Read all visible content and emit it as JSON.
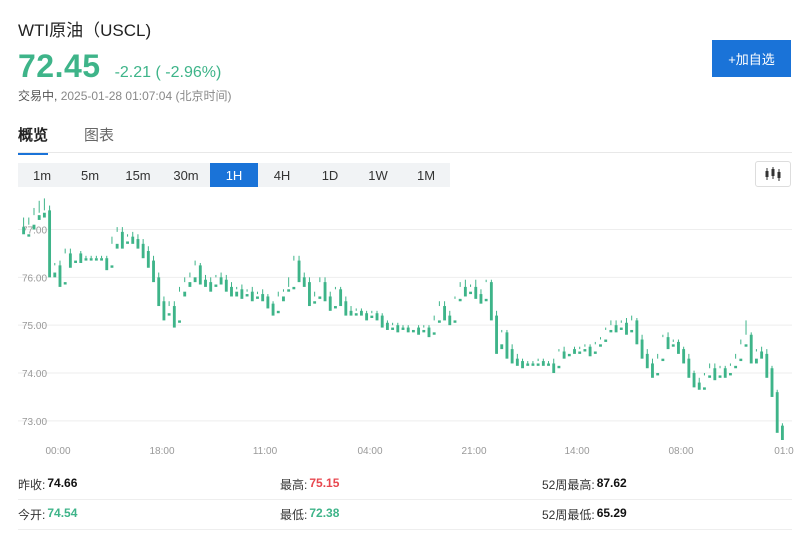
{
  "header": {
    "title": "WTI原油（USCL)",
    "price": "72.45",
    "change": "-2.21 ( -2.96%)",
    "status": "交易中,",
    "datetime": "2025-01-28 01:07:04 (北京时间)",
    "add_button": "+加自选"
  },
  "tabs": [
    {
      "label": "概览",
      "active": true
    },
    {
      "label": "图表",
      "active": false
    }
  ],
  "intervals": [
    {
      "label": "1m",
      "active": false
    },
    {
      "label": "5m",
      "active": false
    },
    {
      "label": "15m",
      "active": false
    },
    {
      "label": "30m",
      "active": false
    },
    {
      "label": "1H",
      "active": true
    },
    {
      "label": "4H",
      "active": false
    },
    {
      "label": "1D",
      "active": false
    },
    {
      "label": "1W",
      "active": false
    },
    {
      "label": "1M",
      "active": false
    }
  ],
  "chart_type_icon": "candlestick-icon",
  "colors": {
    "up": "#e8474f",
    "down": "#3eb489",
    "accent": "#1a73d8"
  },
  "chart_data": {
    "type": "candlestick",
    "y_ticks": [
      "73.00",
      "74.00",
      "75.00",
      "76.00",
      "77.00"
    ],
    "ylim": [
      72.6,
      77.7
    ],
    "x_ticks": [
      "00:00",
      "18:00",
      "11:00",
      "04:00",
      "21:00",
      "14:00",
      "08:00",
      "01:0"
    ],
    "grid": true,
    "candles": [
      [
        77.05,
        77.25,
        76.95,
        76.9
      ],
      [
        76.9,
        77.25,
        77.1,
        76.85
      ],
      [
        77.1,
        77.45,
        77.3,
        77.0
      ],
      [
        77.3,
        77.6,
        77.35,
        77.2
      ],
      [
        77.35,
        77.65,
        77.4,
        77.25
      ],
      [
        77.4,
        77.5,
        76.1,
        76.0
      ],
      [
        76.1,
        76.3,
        76.25,
        76.0
      ],
      [
        76.25,
        76.35,
        75.9,
        75.8
      ],
      [
        75.9,
        76.6,
        76.5,
        75.85
      ],
      [
        76.5,
        76.6,
        76.35,
        76.2
      ],
      [
        76.35,
        76.5,
        76.5,
        76.3
      ],
      [
        76.5,
        76.55,
        76.4,
        76.3
      ],
      [
        76.4,
        76.45,
        76.4,
        76.35
      ],
      [
        76.4,
        76.45,
        76.4,
        76.35
      ],
      [
        76.4,
        76.45,
        76.4,
        76.35
      ],
      [
        76.4,
        76.45,
        76.4,
        76.35
      ],
      [
        76.4,
        76.45,
        76.25,
        76.15
      ],
      [
        76.25,
        76.85,
        76.7,
        76.2
      ],
      [
        76.7,
        77.05,
        76.95,
        76.6
      ],
      [
        76.95,
        77.05,
        76.75,
        76.6
      ],
      [
        76.75,
        76.9,
        76.85,
        76.7
      ],
      [
        76.85,
        76.95,
        76.8,
        76.7
      ],
      [
        76.8,
        76.9,
        76.7,
        76.6
      ],
      [
        76.7,
        76.8,
        76.55,
        76.4
      ],
      [
        76.55,
        76.65,
        76.35,
        76.2
      ],
      [
        76.35,
        76.45,
        76.0,
        75.9
      ],
      [
        76.0,
        76.1,
        75.5,
        75.4
      ],
      [
        75.5,
        75.6,
        75.25,
        75.1
      ],
      [
        75.25,
        75.5,
        75.4,
        75.2
      ],
      [
        75.4,
        75.5,
        75.1,
        74.95
      ],
      [
        75.1,
        75.8,
        75.7,
        75.05
      ],
      [
        75.7,
        76.0,
        75.9,
        75.6
      ],
      [
        75.9,
        76.1,
        76.0,
        75.8
      ],
      [
        76.0,
        76.35,
        76.25,
        75.9
      ],
      [
        76.25,
        76.3,
        75.95,
        75.85
      ],
      [
        75.95,
        76.05,
        75.9,
        75.8
      ],
      [
        75.9,
        76.0,
        75.85,
        75.7
      ],
      [
        75.85,
        76.05,
        76.0,
        75.8
      ],
      [
        76.0,
        76.1,
        75.95,
        75.85
      ],
      [
        75.95,
        76.05,
        75.8,
        75.7
      ],
      [
        75.8,
        75.9,
        75.7,
        75.6
      ],
      [
        75.7,
        75.8,
        75.75,
        75.6
      ],
      [
        75.75,
        75.85,
        75.65,
        75.55
      ],
      [
        75.65,
        75.75,
        75.7,
        75.6
      ],
      [
        75.7,
        75.8,
        75.6,
        75.5
      ],
      [
        75.6,
        75.7,
        75.65,
        75.55
      ],
      [
        75.65,
        75.75,
        75.6,
        75.5
      ],
      [
        75.6,
        75.65,
        75.45,
        75.35
      ],
      [
        75.45,
        75.5,
        75.3,
        75.2
      ],
      [
        75.3,
        75.7,
        75.6,
        75.25
      ],
      [
        75.6,
        75.7,
        75.75,
        75.5
      ],
      [
        75.75,
        76.0,
        75.8,
        75.7
      ],
      [
        75.8,
        76.45,
        76.35,
        75.75
      ],
      [
        76.35,
        76.45,
        76.0,
        75.9
      ],
      [
        76.0,
        76.1,
        75.9,
        75.8
      ],
      [
        75.9,
        76.0,
        75.5,
        75.4
      ],
      [
        75.5,
        75.7,
        75.6,
        75.45
      ],
      [
        75.6,
        76.0,
        75.9,
        75.55
      ],
      [
        75.9,
        76.0,
        75.6,
        75.5
      ],
      [
        75.6,
        75.7,
        75.4,
        75.3
      ],
      [
        75.4,
        75.8,
        75.75,
        75.35
      ],
      [
        75.75,
        75.8,
        75.5,
        75.4
      ],
      [
        75.5,
        75.6,
        75.3,
        75.2
      ],
      [
        75.3,
        75.4,
        75.25,
        75.2
      ],
      [
        75.25,
        75.35,
        75.3,
        75.2
      ],
      [
        75.3,
        75.35,
        75.25,
        75.2
      ],
      [
        75.25,
        75.3,
        75.2,
        75.1
      ],
      [
        75.2,
        75.3,
        75.25,
        75.15
      ],
      [
        75.25,
        75.3,
        75.2,
        75.1
      ],
      [
        75.2,
        75.25,
        75.05,
        74.95
      ],
      [
        75.05,
        75.1,
        74.95,
        74.9
      ],
      [
        74.95,
        75.05,
        75.0,
        74.9
      ],
      [
        75.0,
        75.05,
        74.95,
        74.85
      ],
      [
        74.95,
        75.0,
        74.95,
        74.9
      ],
      [
        74.95,
        75.0,
        74.9,
        74.85
      ],
      [
        74.9,
        74.95,
        74.95,
        74.85
      ],
      [
        74.95,
        75.0,
        74.9,
        74.8
      ],
      [
        74.9,
        75.0,
        74.95,
        74.85
      ],
      [
        74.95,
        75.0,
        74.85,
        74.75
      ],
      [
        74.85,
        75.2,
        75.1,
        74.8
      ],
      [
        75.1,
        75.5,
        75.4,
        75.05
      ],
      [
        75.4,
        75.5,
        75.2,
        75.1
      ],
      [
        75.2,
        75.3,
        75.1,
        75.0
      ],
      [
        75.1,
        75.6,
        75.55,
        75.05
      ],
      [
        75.55,
        75.9,
        75.8,
        75.5
      ],
      [
        75.8,
        75.95,
        75.7,
        75.6
      ],
      [
        75.7,
        75.85,
        75.8,
        75.65
      ],
      [
        75.8,
        75.95,
        75.65,
        75.55
      ],
      [
        75.65,
        75.75,
        75.55,
        75.45
      ],
      [
        75.55,
        75.95,
        75.9,
        75.5
      ],
      [
        75.9,
        75.95,
        75.2,
        75.1
      ],
      [
        75.2,
        75.3,
        74.6,
        74.4
      ],
      [
        74.6,
        74.9,
        74.85,
        74.5
      ],
      [
        74.85,
        74.9,
        74.5,
        74.3
      ],
      [
        74.5,
        74.6,
        74.3,
        74.2
      ],
      [
        74.3,
        74.4,
        74.25,
        74.15
      ],
      [
        74.25,
        74.3,
        74.2,
        74.1
      ],
      [
        74.2,
        74.25,
        74.2,
        74.15
      ],
      [
        74.2,
        74.25,
        74.2,
        74.15
      ],
      [
        74.2,
        74.3,
        74.25,
        74.15
      ],
      [
        74.25,
        74.3,
        74.2,
        74.15
      ],
      [
        74.2,
        74.25,
        74.2,
        74.15
      ],
      [
        74.2,
        74.3,
        74.15,
        74.0
      ],
      [
        74.15,
        74.5,
        74.45,
        74.1
      ],
      [
        74.45,
        74.55,
        74.4,
        74.3
      ],
      [
        74.4,
        74.5,
        74.5,
        74.35
      ],
      [
        74.5,
        74.55,
        74.45,
        74.4
      ],
      [
        74.45,
        74.55,
        74.5,
        74.4
      ],
      [
        74.5,
        74.6,
        74.55,
        74.45
      ],
      [
        74.55,
        74.6,
        74.45,
        74.35
      ],
      [
        74.45,
        74.65,
        74.6,
        74.4
      ],
      [
        74.6,
        74.75,
        74.7,
        74.55
      ],
      [
        74.7,
        74.95,
        74.9,
        74.65
      ],
      [
        74.9,
        75.1,
        75.0,
        74.85
      ],
      [
        75.0,
        75.1,
        74.95,
        74.85
      ],
      [
        74.95,
        75.1,
        75.05,
        74.9
      ],
      [
        75.05,
        75.15,
        74.9,
        74.8
      ],
      [
        74.9,
        75.2,
        75.1,
        74.85
      ],
      [
        75.1,
        75.15,
        74.7,
        74.6
      ],
      [
        74.7,
        74.8,
        74.4,
        74.3
      ],
      [
        74.4,
        74.5,
        74.2,
        74.1
      ],
      [
        74.2,
        74.3,
        74.0,
        73.9
      ],
      [
        74.0,
        74.4,
        74.3,
        73.95
      ],
      [
        74.3,
        74.8,
        74.75,
        74.25
      ],
      [
        74.75,
        74.85,
        74.6,
        74.5
      ],
      [
        74.6,
        74.7,
        74.65,
        74.55
      ],
      [
        74.65,
        74.7,
        74.5,
        74.4
      ],
      [
        74.5,
        74.55,
        74.3,
        74.2
      ],
      [
        74.3,
        74.4,
        74.0,
        73.9
      ],
      [
        74.0,
        74.05,
        73.8,
        73.7
      ],
      [
        73.8,
        73.9,
        73.7,
        73.65
      ],
      [
        73.7,
        74.0,
        73.95,
        73.65
      ],
      [
        73.95,
        74.2,
        74.1,
        73.9
      ],
      [
        74.1,
        74.2,
        73.95,
        73.85
      ],
      [
        73.95,
        74.15,
        74.1,
        73.9
      ],
      [
        74.1,
        74.15,
        74.0,
        73.9
      ],
      [
        74.0,
        74.2,
        74.15,
        73.95
      ],
      [
        74.15,
        74.4,
        74.3,
        74.1
      ],
      [
        74.3,
        74.7,
        74.6,
        74.25
      ],
      [
        74.6,
        75.1,
        74.8,
        74.55
      ],
      [
        74.8,
        74.85,
        74.3,
        74.2
      ],
      [
        74.3,
        74.5,
        74.45,
        74.2
      ],
      [
        74.45,
        74.55,
        74.4,
        74.3
      ],
      [
        74.4,
        74.5,
        74.1,
        73.9
      ],
      [
        74.1,
        74.15,
        73.6,
        73.5
      ],
      [
        73.6,
        73.65,
        72.9,
        72.75
      ],
      [
        72.9,
        72.95,
        72.7,
        72.6
      ]
    ]
  },
  "stats": {
    "prev_close_label": "昨收:",
    "prev_close": "74.66",
    "high_label": "最高:",
    "high": "75.15",
    "high52_label": "52周最高:",
    "high52": "87.62",
    "open_label": "今开:",
    "open": "74.54",
    "low_label": "最低:",
    "low": "72.38",
    "low52_label": "52周最低:",
    "low52": "65.29"
  }
}
